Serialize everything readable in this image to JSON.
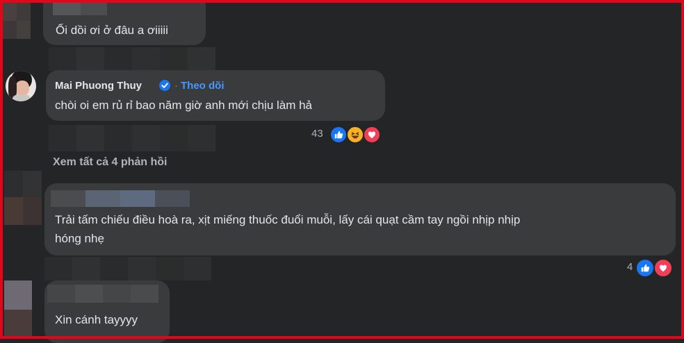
{
  "comments": [
    {
      "text": "Ối dồi ơi ở đâu a ơiiiii"
    },
    {
      "author": "Mai Phuong Thuy",
      "follow_separator": "·",
      "follow_label": "Theo dõi",
      "text": "chòi oi em rủ rỉ bao năm giờ anh mới chịu làm hả",
      "reaction_count": "43",
      "reactions": [
        "like-icon",
        "haha-icon",
        "love-icon"
      ]
    },
    {
      "text_line1": "Trải tấm chiếu điều hoà ra, xịt miếng thuốc đuổi muỗi, lấy cái quạt cầm tay ngồi nhịp nhịp",
      "text_line2": "hóng nhẹ",
      "reaction_count": "4",
      "reactions": [
        "like-icon",
        "love-icon"
      ]
    },
    {
      "text": "Xin cánh tayyyy"
    }
  ],
  "view_replies": "Xem tất cả 4 phản hồi",
  "colors": {
    "frame": "#e0071b",
    "background": "#242526",
    "bubble": "#3a3b3c",
    "link": "#4599ff",
    "like": "#1877f2",
    "love": "#f33e58",
    "haha": "#f7b125"
  }
}
